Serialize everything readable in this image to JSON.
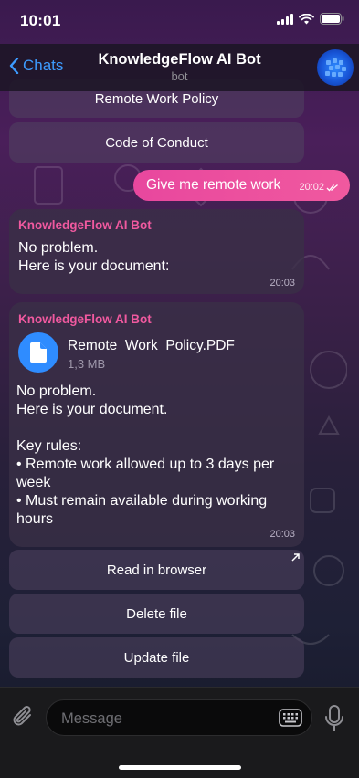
{
  "status_bar": {
    "time": "10:01"
  },
  "header": {
    "back_label": "Chats",
    "title": "KnowledgeFlow AI Bot",
    "subtitle": "bot"
  },
  "keyboard_top": {
    "buttons": [
      "Remote Work Policy",
      "Code of Conduct"
    ]
  },
  "outgoing_message": {
    "text": "Give me remote work",
    "time": "20:02"
  },
  "message_1": {
    "sender": "KnowledgeFlow AI Bot",
    "text": "No problem.\nHere is your document:",
    "time": "20:03"
  },
  "message_2": {
    "sender": "KnowledgeFlow AI Bot",
    "file_name": "Remote_Work_Policy.PDF",
    "file_size": "1,3 MB",
    "text": "No problem.\nHere is your document.\n\nKey rules:\n• Remote work allowed up to 3 days per week\n• Must remain available during working hours",
    "time": "20:03"
  },
  "inline_buttons": [
    "Read in browser",
    "Delete file",
    "Update file"
  ],
  "input": {
    "placeholder": "Message"
  },
  "colors": {
    "accent": "#3d9bff",
    "outgoing_bubble": "#ee4f9e",
    "sender_name": "#f0599f",
    "file_icon": "#2f8cff"
  }
}
